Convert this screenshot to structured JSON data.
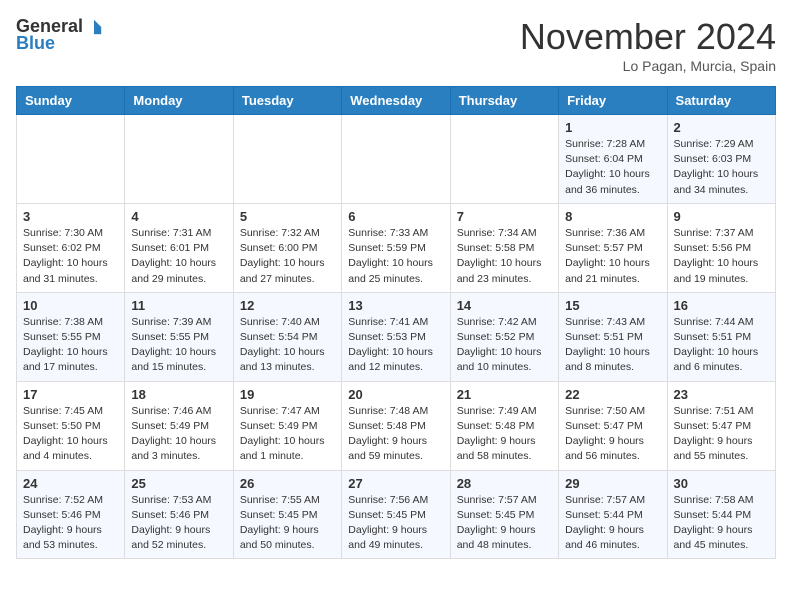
{
  "header": {
    "logo_general": "General",
    "logo_blue": "Blue",
    "month_title": "November 2024",
    "subtitle": "Lo Pagan, Murcia, Spain"
  },
  "weekdays": [
    "Sunday",
    "Monday",
    "Tuesday",
    "Wednesday",
    "Thursday",
    "Friday",
    "Saturday"
  ],
  "weeks": [
    [
      {
        "day": "",
        "info": ""
      },
      {
        "day": "",
        "info": ""
      },
      {
        "day": "",
        "info": ""
      },
      {
        "day": "",
        "info": ""
      },
      {
        "day": "",
        "info": ""
      },
      {
        "day": "1",
        "info": "Sunrise: 7:28 AM\nSunset: 6:04 PM\nDaylight: 10 hours and 36 minutes."
      },
      {
        "day": "2",
        "info": "Sunrise: 7:29 AM\nSunset: 6:03 PM\nDaylight: 10 hours and 34 minutes."
      }
    ],
    [
      {
        "day": "3",
        "info": "Sunrise: 7:30 AM\nSunset: 6:02 PM\nDaylight: 10 hours and 31 minutes."
      },
      {
        "day": "4",
        "info": "Sunrise: 7:31 AM\nSunset: 6:01 PM\nDaylight: 10 hours and 29 minutes."
      },
      {
        "day": "5",
        "info": "Sunrise: 7:32 AM\nSunset: 6:00 PM\nDaylight: 10 hours and 27 minutes."
      },
      {
        "day": "6",
        "info": "Sunrise: 7:33 AM\nSunset: 5:59 PM\nDaylight: 10 hours and 25 minutes."
      },
      {
        "day": "7",
        "info": "Sunrise: 7:34 AM\nSunset: 5:58 PM\nDaylight: 10 hours and 23 minutes."
      },
      {
        "day": "8",
        "info": "Sunrise: 7:36 AM\nSunset: 5:57 PM\nDaylight: 10 hours and 21 minutes."
      },
      {
        "day": "9",
        "info": "Sunrise: 7:37 AM\nSunset: 5:56 PM\nDaylight: 10 hours and 19 minutes."
      }
    ],
    [
      {
        "day": "10",
        "info": "Sunrise: 7:38 AM\nSunset: 5:55 PM\nDaylight: 10 hours and 17 minutes."
      },
      {
        "day": "11",
        "info": "Sunrise: 7:39 AM\nSunset: 5:55 PM\nDaylight: 10 hours and 15 minutes."
      },
      {
        "day": "12",
        "info": "Sunrise: 7:40 AM\nSunset: 5:54 PM\nDaylight: 10 hours and 13 minutes."
      },
      {
        "day": "13",
        "info": "Sunrise: 7:41 AM\nSunset: 5:53 PM\nDaylight: 10 hours and 12 minutes."
      },
      {
        "day": "14",
        "info": "Sunrise: 7:42 AM\nSunset: 5:52 PM\nDaylight: 10 hours and 10 minutes."
      },
      {
        "day": "15",
        "info": "Sunrise: 7:43 AM\nSunset: 5:51 PM\nDaylight: 10 hours and 8 minutes."
      },
      {
        "day": "16",
        "info": "Sunrise: 7:44 AM\nSunset: 5:51 PM\nDaylight: 10 hours and 6 minutes."
      }
    ],
    [
      {
        "day": "17",
        "info": "Sunrise: 7:45 AM\nSunset: 5:50 PM\nDaylight: 10 hours and 4 minutes."
      },
      {
        "day": "18",
        "info": "Sunrise: 7:46 AM\nSunset: 5:49 PM\nDaylight: 10 hours and 3 minutes."
      },
      {
        "day": "19",
        "info": "Sunrise: 7:47 AM\nSunset: 5:49 PM\nDaylight: 10 hours and 1 minute."
      },
      {
        "day": "20",
        "info": "Sunrise: 7:48 AM\nSunset: 5:48 PM\nDaylight: 9 hours and 59 minutes."
      },
      {
        "day": "21",
        "info": "Sunrise: 7:49 AM\nSunset: 5:48 PM\nDaylight: 9 hours and 58 minutes."
      },
      {
        "day": "22",
        "info": "Sunrise: 7:50 AM\nSunset: 5:47 PM\nDaylight: 9 hours and 56 minutes."
      },
      {
        "day": "23",
        "info": "Sunrise: 7:51 AM\nSunset: 5:47 PM\nDaylight: 9 hours and 55 minutes."
      }
    ],
    [
      {
        "day": "24",
        "info": "Sunrise: 7:52 AM\nSunset: 5:46 PM\nDaylight: 9 hours and 53 minutes."
      },
      {
        "day": "25",
        "info": "Sunrise: 7:53 AM\nSunset: 5:46 PM\nDaylight: 9 hours and 52 minutes."
      },
      {
        "day": "26",
        "info": "Sunrise: 7:55 AM\nSunset: 5:45 PM\nDaylight: 9 hours and 50 minutes."
      },
      {
        "day": "27",
        "info": "Sunrise: 7:56 AM\nSunset: 5:45 PM\nDaylight: 9 hours and 49 minutes."
      },
      {
        "day": "28",
        "info": "Sunrise: 7:57 AM\nSunset: 5:45 PM\nDaylight: 9 hours and 48 minutes."
      },
      {
        "day": "29",
        "info": "Sunrise: 7:57 AM\nSunset: 5:44 PM\nDaylight: 9 hours and 46 minutes."
      },
      {
        "day": "30",
        "info": "Sunrise: 7:58 AM\nSunset: 5:44 PM\nDaylight: 9 hours and 45 minutes."
      }
    ]
  ]
}
